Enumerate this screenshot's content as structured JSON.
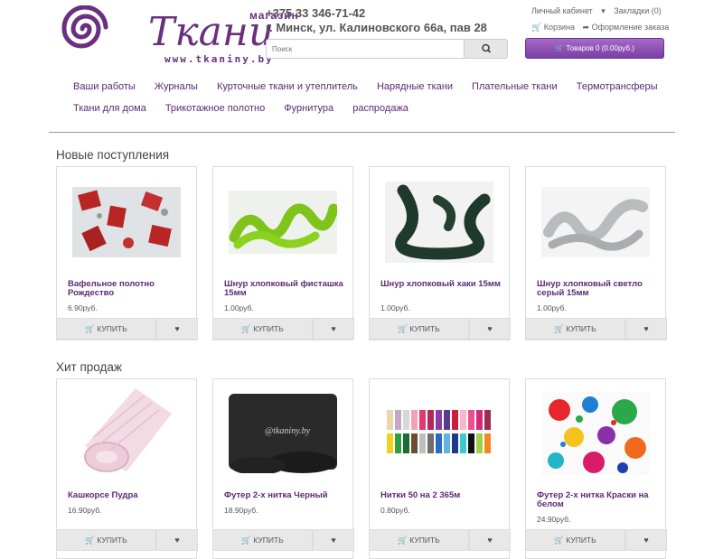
{
  "header": {
    "logo_small": "магазин",
    "logo_big": "Ткани",
    "logo_url": "www.tkaniny.by",
    "phone": "+375 33 346-71-42",
    "address": "г. Минск, ул. Калиновского 66а, пав 28",
    "search_placeholder": "Поиск",
    "account_label": "Личный кабинет",
    "bookmarks_label": "Закладки (0)",
    "cart_link": "Корзина",
    "checkout_link": "Оформление заказа",
    "cart_button": "Товаров 0 (0.00руб.)"
  },
  "nav": {
    "row1": [
      "Ваши работы",
      "Журналы",
      "Курточные ткани и утеплитель",
      "Нарядные ткани",
      "Плательные ткани",
      "Термотрансферы"
    ],
    "row2": [
      "Ткани для дома",
      "Трикотажное полотно",
      "Фурнитура",
      "распродажа"
    ]
  },
  "sections": [
    {
      "title": "Новые поступления",
      "products": [
        {
          "name": "Вафельное полотно Рождество",
          "price": "6.90руб."
        },
        {
          "name": "Шнур хлопковый фисташка 15мм",
          "price": "1.00руб."
        },
        {
          "name": "Шнур хлопковый хаки 15мм",
          "price": "1.00руб."
        },
        {
          "name": "Шнур хлопковый светло серый 15мм",
          "price": "1.00руб."
        }
      ]
    },
    {
      "title": "Хит продаж",
      "products": [
        {
          "name": "Кашкорсе Пудра",
          "price": "16.90руб."
        },
        {
          "name": "Футер 2-х нитка Черный",
          "price": "18.90руб."
        },
        {
          "name": "Нитки 50 на 2 365м",
          "price": "0.80руб."
        },
        {
          "name": "Футер 2-х нитка Краски на белом",
          "price": "24.90руб."
        }
      ]
    }
  ],
  "buy_label": "КУПИТЬ",
  "watermark": "@tkaniny.by",
  "colors": {
    "brand": "#6b2f7f",
    "link": "#5b2a72",
    "cart": "#7a3ea6"
  }
}
